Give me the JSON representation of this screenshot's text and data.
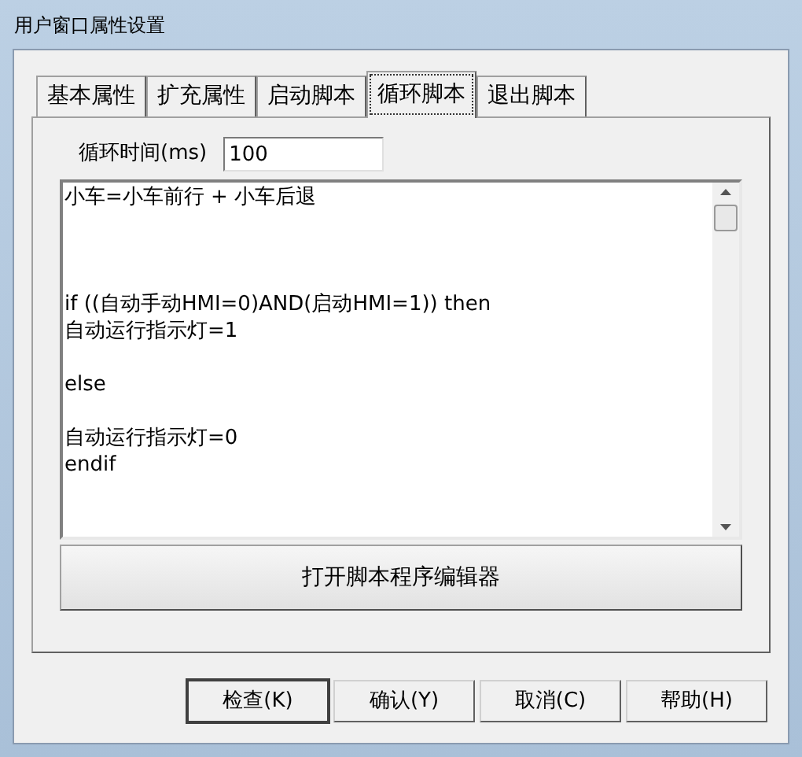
{
  "window": {
    "title": "用户窗口属性设置"
  },
  "tabs": [
    {
      "label": "基本属性",
      "selected": false
    },
    {
      "label": "扩充属性",
      "selected": false
    },
    {
      "label": "启动脚本",
      "selected": false
    },
    {
      "label": "循环脚本",
      "selected": true
    },
    {
      "label": "退出脚本",
      "selected": false
    }
  ],
  "loop_time": {
    "label": "循环时间(ms)",
    "value": "100"
  },
  "script_lines": [
    {
      "kind": "code",
      "text": "小车=小车前行 + 小车后退"
    },
    {
      "kind": "blank"
    },
    {
      "kind": "blank"
    },
    {
      "kind": "blank"
    },
    {
      "kind": "code",
      "text": "if ((自动手动HMI=0)AND(启动HMI=1)) then"
    },
    {
      "kind": "code",
      "text": "自动运行指示灯=1"
    },
    {
      "kind": "blank"
    },
    {
      "kind": "code",
      "text": "else"
    },
    {
      "kind": "blank"
    },
    {
      "kind": "code",
      "text": "自动运行指示灯=0"
    },
    {
      "kind": "code",
      "text": "endif"
    }
  ],
  "editor_button": "打开脚本程序编辑器",
  "buttons": [
    {
      "label": "检查(K)",
      "default": true
    },
    {
      "label": "确认(Y)",
      "default": false
    },
    {
      "label": "取消(C)",
      "default": false
    },
    {
      "label": "帮助(H)",
      "default": false
    }
  ]
}
